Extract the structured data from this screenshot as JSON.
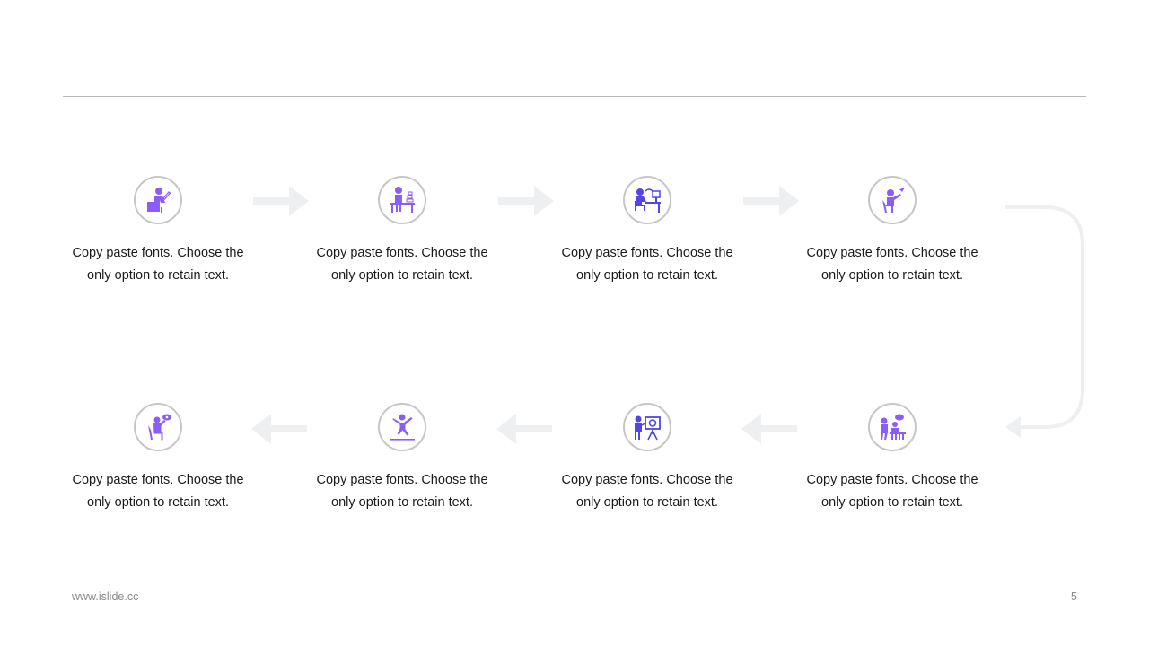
{
  "colors": {
    "accent": "#8b5cf6",
    "accent_blue": "#4f46e5",
    "ring": "#c6c6c6",
    "arrow": "#eeeff1",
    "rule": "#b8b8b8"
  },
  "steps": [
    {
      "icon": "person-desk-writing-icon",
      "line1": "Copy paste fonts. Choose the",
      "line2": "only option to retain text."
    },
    {
      "icon": "person-desk-books-icon",
      "line1": "Copy paste fonts. Choose the",
      "line2": "only option to retain text."
    },
    {
      "icon": "person-computer-desk-icon",
      "line1": "Copy paste fonts. Choose the",
      "line2": "only option to retain text."
    },
    {
      "icon": "person-desk-pointing-icon",
      "line1": "Copy paste fonts. Choose the",
      "line2": "only option to retain text."
    },
    {
      "icon": "people-discussion-icon",
      "line1": "Copy paste fonts. Choose the",
      "line2": "only option to retain text."
    },
    {
      "icon": "presenter-board-icon",
      "line1": "Copy paste fonts. Choose the",
      "line2": "only option to retain text."
    },
    {
      "icon": "person-jumping-icon",
      "line1": "Copy paste fonts. Choose the",
      "line2": "only option to retain text."
    },
    {
      "icon": "person-sitting-speech-icon",
      "line1": "Copy paste fonts. Choose the",
      "line2": "only option to retain text."
    }
  ],
  "footer": {
    "url": "www.islide.cc",
    "page": "5"
  }
}
